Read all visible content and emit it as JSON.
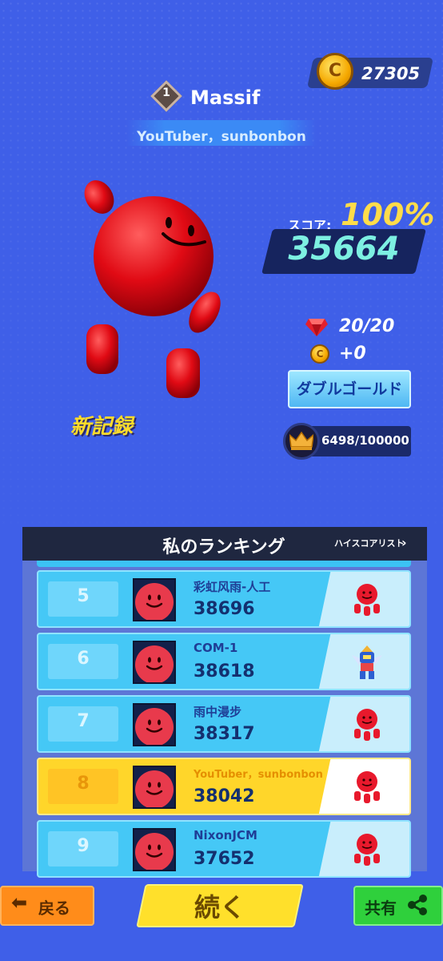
{
  "currency": {
    "coins": "27305",
    "coin_symbol": "C"
  },
  "player": {
    "rank_badge": "1",
    "name": "Massif",
    "channel": "YouTuber，sunbonbon"
  },
  "score": {
    "label": "スコア:",
    "percent": "100%",
    "value": "35664"
  },
  "rewards": {
    "gems": "20/20",
    "coins_gained": "+0",
    "coin_symbol": "C",
    "double_gold_label": "ダブルゴールド"
  },
  "crown_progress": {
    "text": "6498/100000",
    "fraction": 0.065
  },
  "new_record": "新記録",
  "ranking": {
    "title": "私のランキング",
    "high_score_link": "ハイスコアリスト",
    "chevron": "›",
    "rows": [
      {
        "rank": "5",
        "name": "彩虹风雨-人工",
        "score": "38696",
        "skin": "red-octopus-icon"
      },
      {
        "rank": "6",
        "name": "COM-1",
        "score": "38618",
        "skin": "robot-mech-icon"
      },
      {
        "rank": "7",
        "name": "雨中漫步",
        "score": "38317",
        "skin": "red-octopus-icon"
      },
      {
        "rank": "8",
        "name": "YouTuber，sunbonbon",
        "score": "38042",
        "skin": "red-octopus-icon",
        "is_me": true
      },
      {
        "rank": "9",
        "name": "NixonJCM",
        "score": "37652",
        "skin": "red-octopus-icon"
      }
    ]
  },
  "buttons": {
    "back_arrow": "⬅",
    "back": "戻る",
    "continue": "続く",
    "share": "共有"
  },
  "colors": {
    "background": "#3f5fe8",
    "gold": "#ffdc4a",
    "score_teal": "#7df0e2",
    "row_blue": "#45c8f6",
    "row_me": "#ffd62a"
  }
}
